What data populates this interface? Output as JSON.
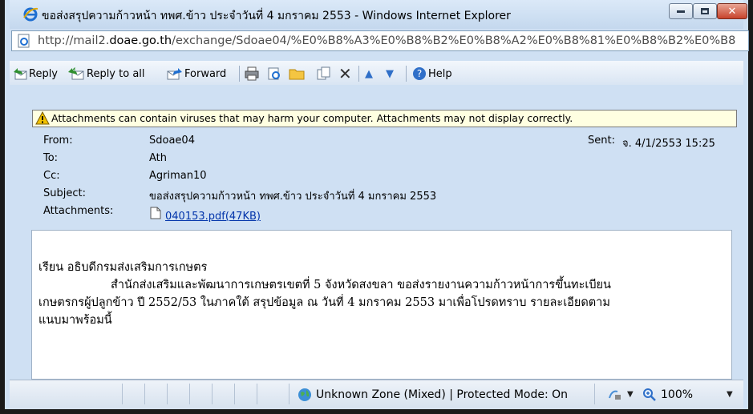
{
  "window": {
    "title": "ขอส่งสรุปความก้าวหน้า ทพศ.ข้าว ประจำวันที่ 4 มกราคม 2553 - Windows Internet Explorer"
  },
  "address": {
    "prefix": "http://mail2.",
    "domain": "doae.go.th",
    "path": "/exchange/Sdoae04/%E0%B8%A3%E0%B8%B2%E0%B8%A2%E0%B8%81%E0%B8%B2%E0%B8"
  },
  "toolbar": {
    "reply": "Reply",
    "reply_all": "Reply to all",
    "forward": "Forward",
    "help": "Help"
  },
  "warning": "Attachments can contain viruses that may harm your computer. Attachments may not display correctly.",
  "headers": {
    "from_label": "From:",
    "from": "Sdoae04",
    "to_label": "To:",
    "to": "Ath",
    "cc_label": "Cc:",
    "cc": "Agriman10",
    "subject_label": "Subject:",
    "subject": "ขอส่งสรุปความก้าวหน้า ทพศ.ข้าว ประจำวันที่ 4 มกราคม 2553",
    "attachments_label": "Attachments:",
    "attachment": "040153.pdf(47KB)",
    "sent_label": "Sent:",
    "sent": "จ. 4/1/2553 15:25"
  },
  "body": {
    "line1": "เรียน  อธิบดีกรมส่งเสริมการเกษตร",
    "line2": "สำนักส่งเสริมและพัฒนาการเกษตรเขตที่ 5 จังหวัดสงขลา ขอส่งรายงานความก้าวหน้าการขึ้นทะเบียน",
    "line3": "เกษตรกรผู้ปลูกข้าว ปี 2552/53 ในภาคใต้ สรุปข้อมูล ณ วันที่ 4 มกราคม 2553 มาเพื่อโปรดทราบ รายละเอียดตาม",
    "line4": "แนบมาพร้อมนี้"
  },
  "status": {
    "zone": "Unknown Zone (Mixed) | Protected Mode: On",
    "zoom": "100%"
  },
  "icons": [
    "ie-icon",
    "reply-icon",
    "reply-all-icon",
    "forward-icon",
    "print-icon",
    "move-icon",
    "folder-icon",
    "copy-icon",
    "delete-icon",
    "up-icon",
    "down-icon",
    "help-icon",
    "warning-icon",
    "attachment-icon",
    "globe-icon",
    "zoom-icon"
  ]
}
